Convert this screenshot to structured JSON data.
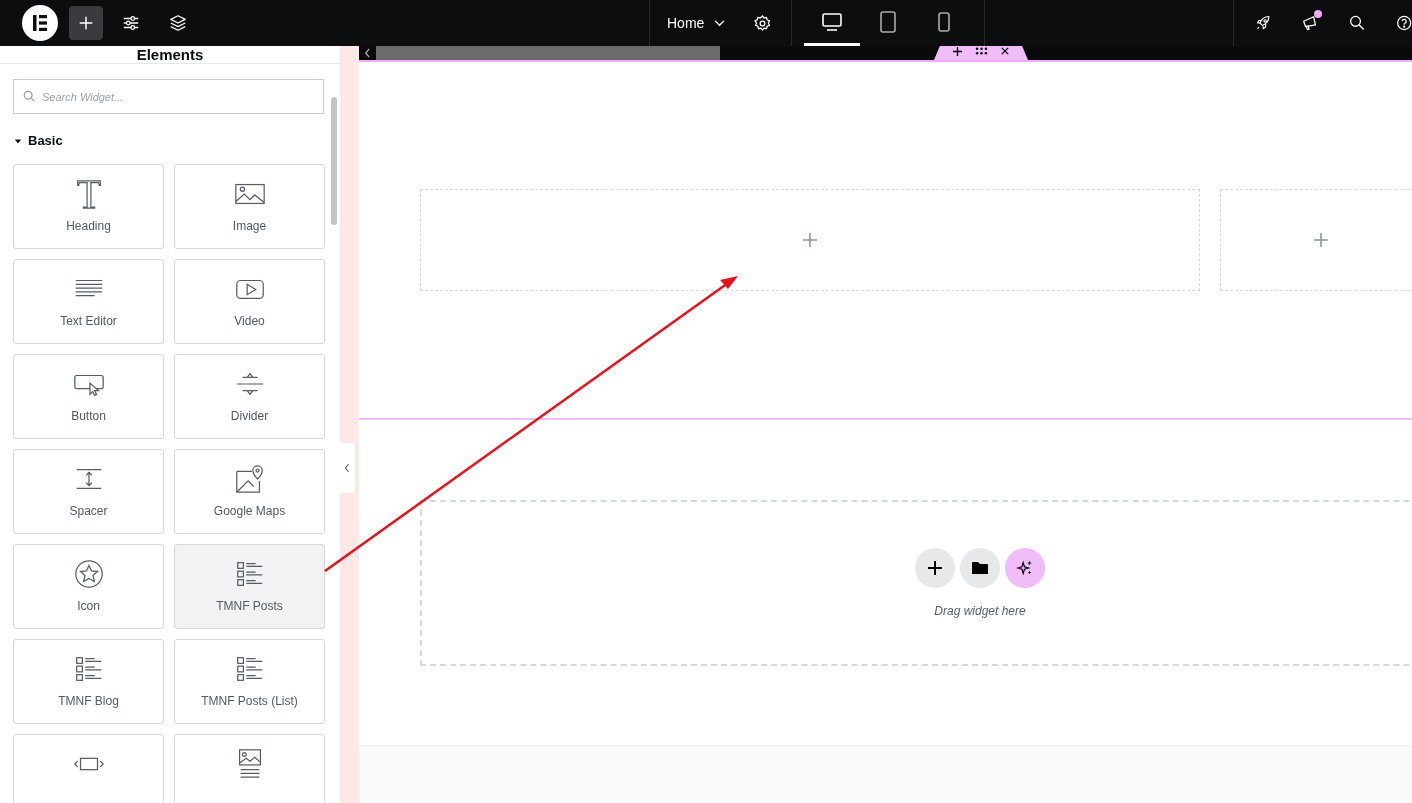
{
  "topbar": {
    "page_menu": "Home",
    "notification": true,
    "devices": [
      {
        "kind": "desktop",
        "selected": true
      },
      {
        "kind": "tablet",
        "selected": false
      },
      {
        "kind": "mobile",
        "selected": false
      }
    ]
  },
  "panel": {
    "title": "Elements",
    "search": {
      "placeholder": "Search Widget..."
    },
    "category": {
      "label": "Basic",
      "expanded": true
    },
    "widgets": [
      {
        "kind": "heading",
        "label": "Heading",
        "selected": false
      },
      {
        "kind": "image",
        "label": "Image",
        "selected": false
      },
      {
        "kind": "text",
        "label": "Text Editor",
        "selected": false
      },
      {
        "kind": "video",
        "label": "Video",
        "selected": false
      },
      {
        "kind": "button",
        "label": "Button",
        "selected": false
      },
      {
        "kind": "divider",
        "label": "Divider",
        "selected": false
      },
      {
        "kind": "spacer",
        "label": "Spacer",
        "selected": false
      },
      {
        "kind": "map",
        "label": "Google Maps",
        "selected": false
      },
      {
        "kind": "star",
        "label": "Icon",
        "selected": false
      },
      {
        "kind": "posts",
        "label": "TMNF Posts",
        "selected": true
      },
      {
        "kind": "posts",
        "label": "TMNF Blog",
        "selected": false
      },
      {
        "kind": "posts",
        "label": "TMNF Posts (List)",
        "selected": false
      },
      {
        "kind": "frame",
        "selected": false
      },
      {
        "kind": "image-text",
        "selected": false
      }
    ]
  },
  "canvas": {
    "drop_zone": {
      "hint": "Drag widget here"
    }
  }
}
